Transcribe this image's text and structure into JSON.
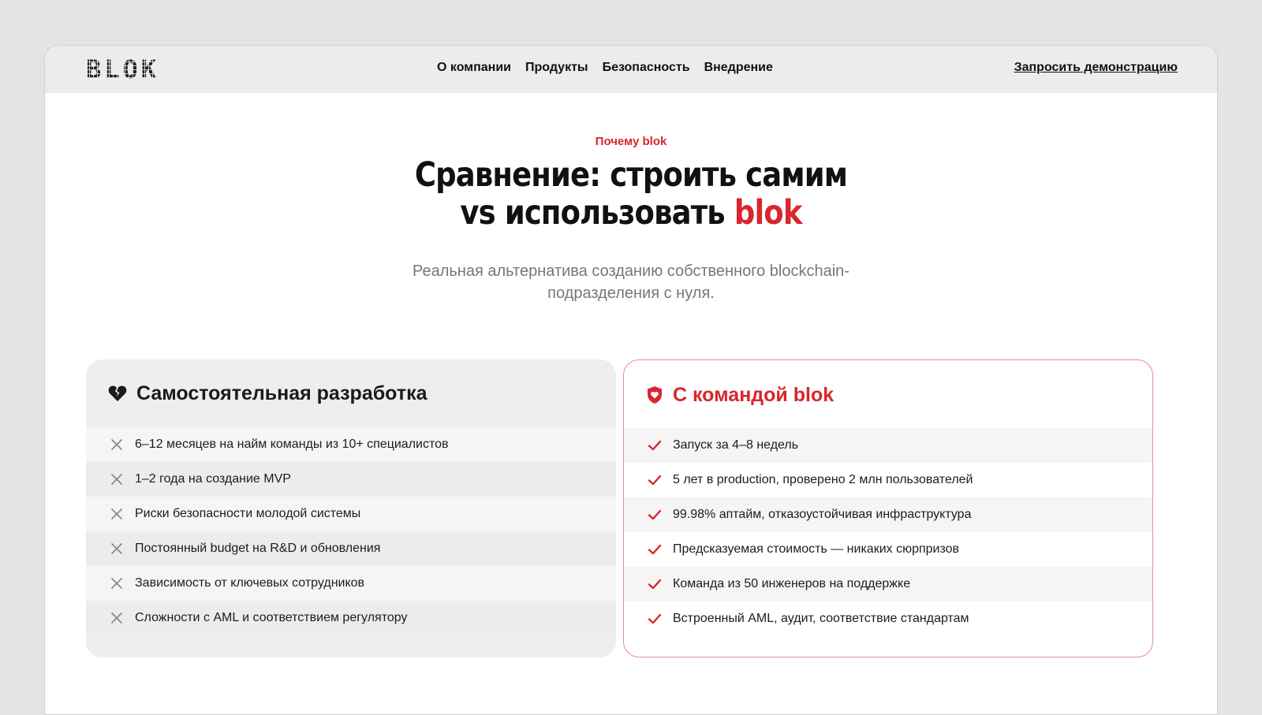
{
  "header": {
    "logo_letters": [
      "B",
      "L",
      "O",
      "K"
    ],
    "nav": [
      "О компании",
      "Продукты",
      "Безопасность",
      "Внедрение"
    ],
    "cta": "Запросить демонстрацию"
  },
  "hero": {
    "eyebrow": "Почему blok",
    "title_line1": "Сравнение: строить самим",
    "title_line2_prefix": "vs использовать ",
    "title_line2_accent": "blok",
    "subtitle_line1": "Реальная альтернатива созданию собственного blockchain-",
    "subtitle_line2": "подразделения с нуля."
  },
  "comparison": {
    "self": {
      "title": "Самостоятельная разработка",
      "icon": "broken-heart-icon",
      "items": [
        "6–12 месяцев на найм команды из 10+ специалистов",
        "1–2 года на создание MVP",
        "Риски безопасности молодой системы",
        "Постоянный budget на R&D и обновления",
        "Зависимость от ключевых сотрудников",
        "Сложности с AML и соответствием регулятору"
      ]
    },
    "blok": {
      "title": "С командой blok",
      "icon": "shield-heart-icon",
      "items": [
        "Запуск за 4–8 недель",
        "5 лет в production, проверено 2 млн пользователей",
        "99.98% аптайм, отказоустойчивая инфраструктура",
        "Предсказуемая стоимость — никаких сюрпризов",
        "Команда из 50 инженеров на поддержке",
        "Встроенный AML, аудит, соответствие стандартам"
      ]
    }
  },
  "colors": {
    "accent": "#d8262c",
    "border_accent": "#ee8a8f",
    "header_bg": "#ececec",
    "muted_text": "#777777"
  }
}
